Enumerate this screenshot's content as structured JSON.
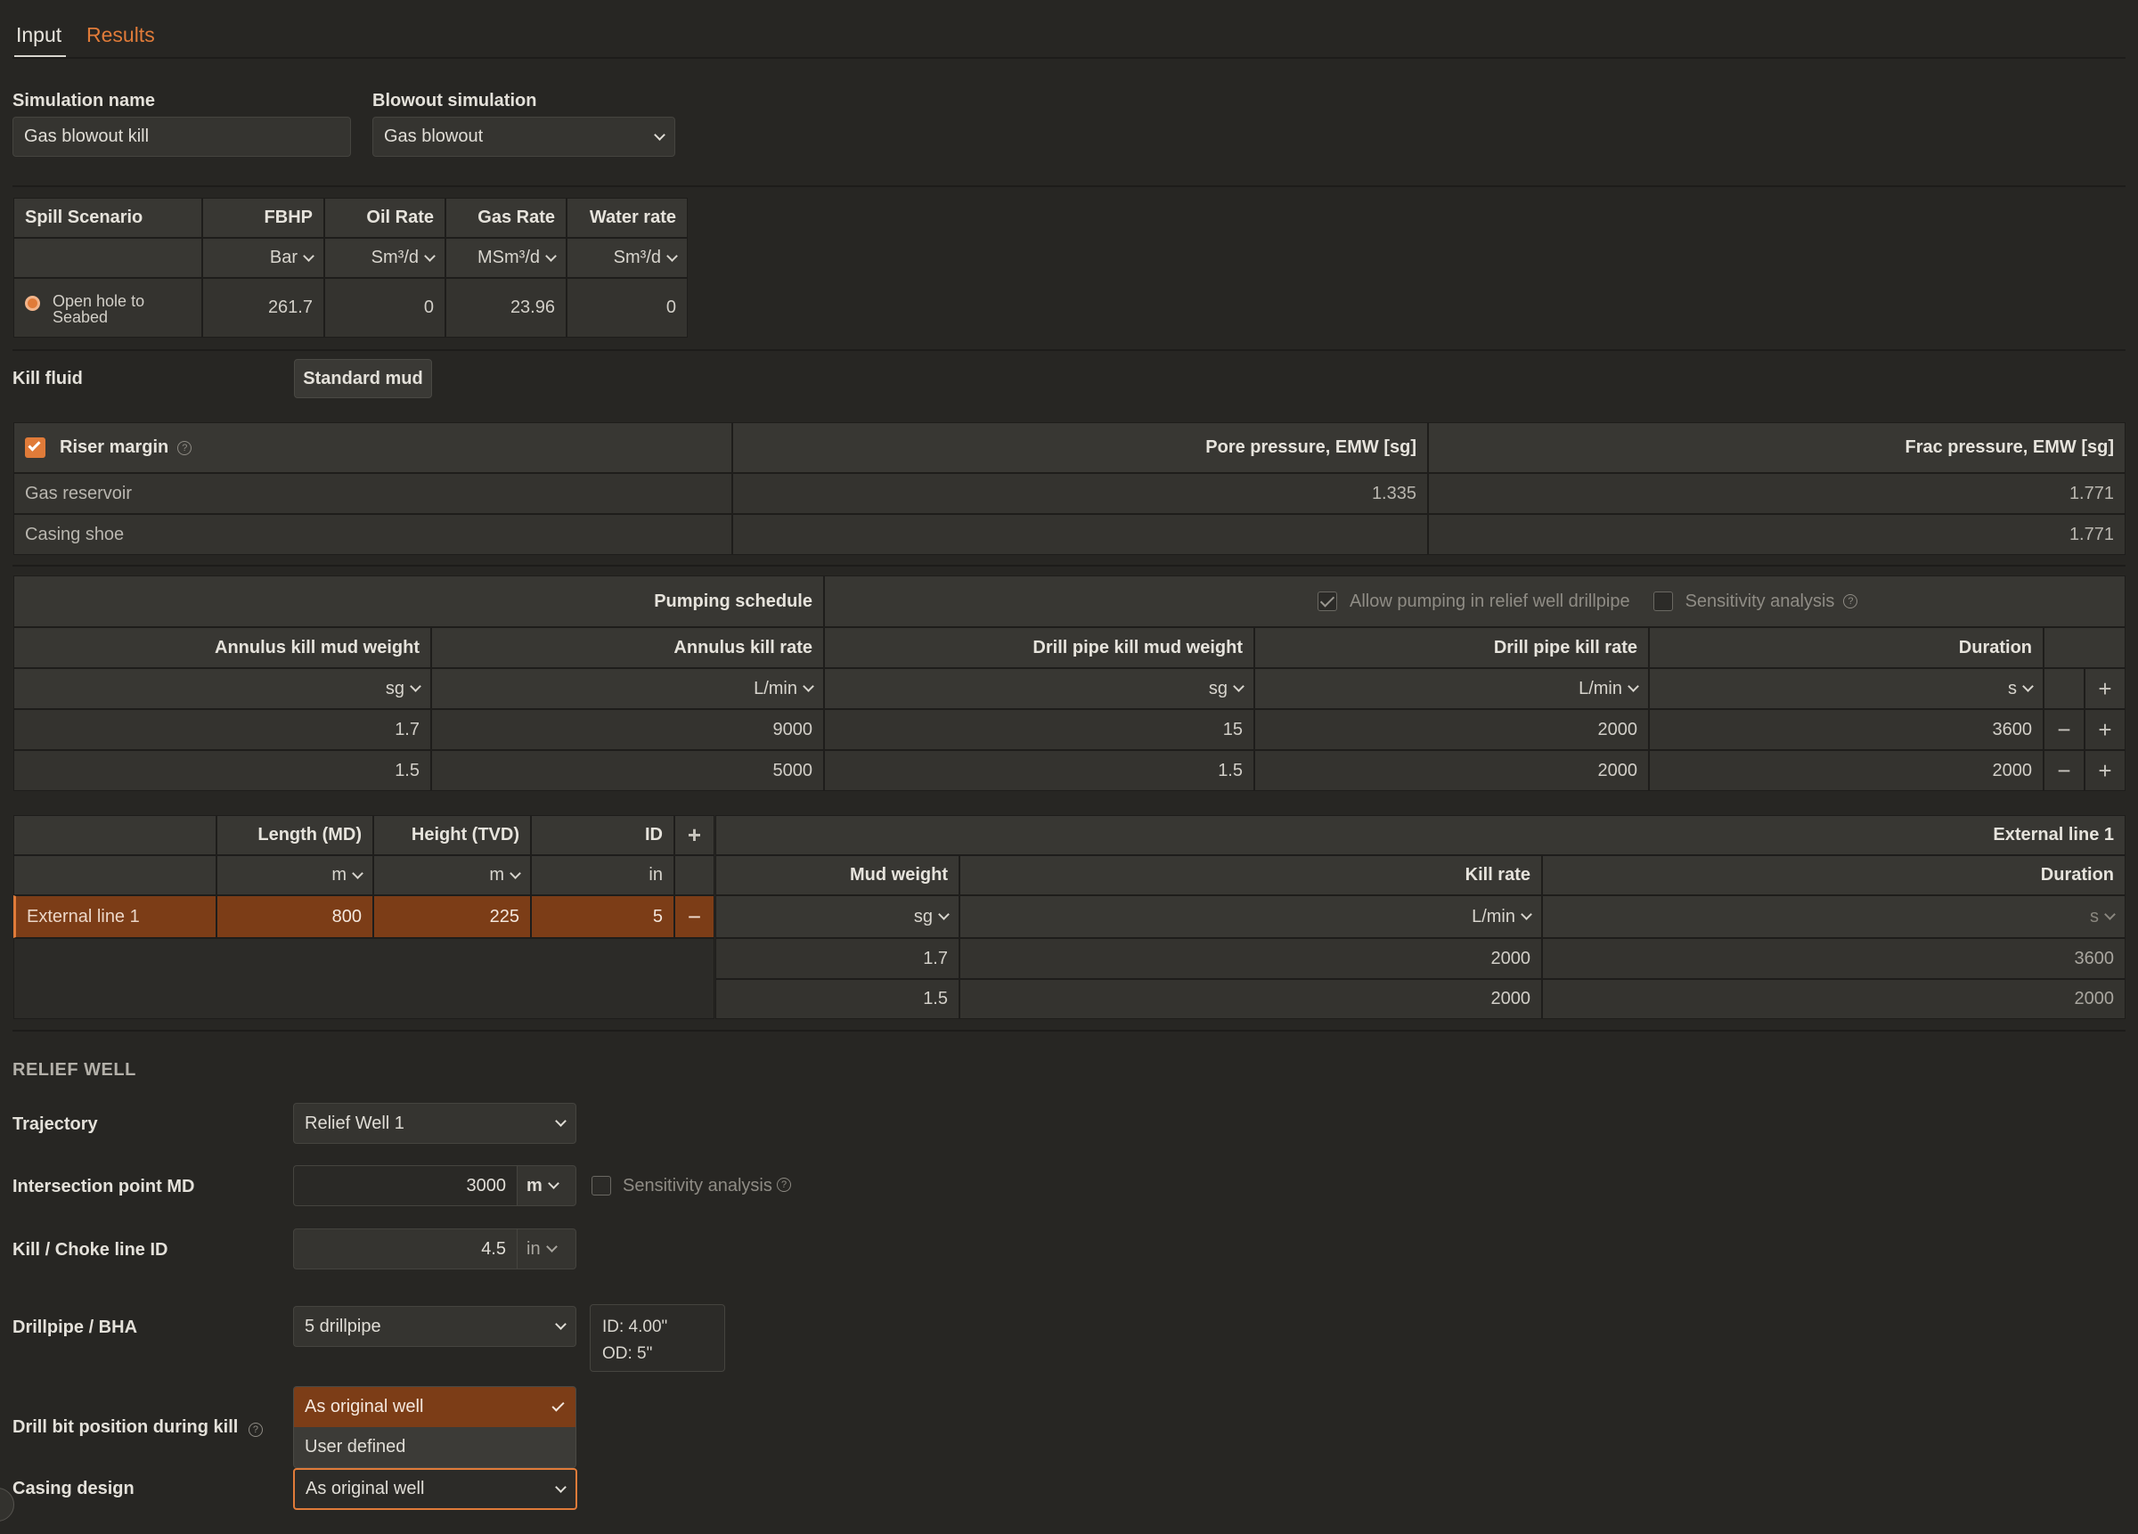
{
  "tabs": {
    "input": "Input",
    "results": "Results"
  },
  "simulation": {
    "name_label": "Simulation name",
    "name_value": "Gas blowout kill",
    "blowout_label": "Blowout simulation",
    "blowout_value": "Gas blowout"
  },
  "spill": {
    "headers": [
      "Spill Scenario",
      "FBHP",
      "Oil Rate",
      "Gas Rate",
      "Water rate"
    ],
    "units": [
      "Bar",
      "Sm³/d",
      "MSm³/d",
      "Sm³/d"
    ],
    "row": {
      "scenario": "Open hole to Seabed",
      "fbhp": "261.7",
      "oil": "0",
      "gas": "23.96",
      "water": "0"
    }
  },
  "kill_fluid": {
    "label": "Kill fluid",
    "button": "Standard mud"
  },
  "margins": {
    "riser_label": "Riser margin",
    "pore_header": "Pore pressure, EMW [sg]",
    "frac_header": "Frac pressure, EMW [sg]",
    "rows": [
      {
        "name": "Gas reservoir",
        "pore": "1.335",
        "frac": "1.771"
      },
      {
        "name": "Casing shoe",
        "pore": "",
        "frac": "1.771"
      }
    ]
  },
  "pumping": {
    "title": "Pumping schedule",
    "allow_label": "Allow pumping in relief well drillpipe",
    "sensitivity_label": "Sensitivity analysis",
    "headers": [
      "Annulus kill mud weight",
      "Annulus kill rate",
      "Drill pipe kill mud weight",
      "Drill pipe kill rate",
      "Duration"
    ],
    "units": [
      "sg",
      "L/min",
      "sg",
      "L/min",
      "s"
    ],
    "rows": [
      [
        "1.7",
        "9000",
        "15",
        "2000",
        "3600"
      ],
      [
        "1.5",
        "5000",
        "1.5",
        "2000",
        "2000"
      ]
    ]
  },
  "lines": {
    "headers": [
      "Length (MD)",
      "Height (TVD)",
      "ID"
    ],
    "units": [
      "m",
      "m",
      "in"
    ],
    "row": {
      "name": "External line 1",
      "length": "800",
      "height": "225",
      "id": "5"
    }
  },
  "ext": {
    "title": "External line 1",
    "headers": [
      "Mud weight",
      "Kill rate",
      "Duration"
    ],
    "units": [
      "sg",
      "L/min",
      "s"
    ],
    "rows": [
      [
        "1.7",
        "2000",
        "3600"
      ],
      [
        "1.5",
        "2000",
        "2000"
      ]
    ]
  },
  "relief": {
    "section": "RELIEF WELL",
    "trajectory_label": "Trajectory",
    "trajectory_value": "Relief Well 1",
    "ip_label": "Intersection point MD",
    "ip_value": "3000",
    "ip_unit": "m",
    "ip_sens": "Sensitivity analysis",
    "kc_label": "Kill / Choke line ID",
    "kc_value": "4.5",
    "kc_unit": "in",
    "dp_label": "Drillpipe / BHA",
    "dp_value": "5 drillpipe",
    "dp_id": "ID:  4.00\"",
    "dp_od": "OD: 5\"",
    "bit_label": "Drill bit position during kill",
    "bit_options": [
      "As original well",
      "User defined"
    ],
    "casing_label": "Casing design",
    "casing_value": "As original well"
  },
  "colors": {
    "accent": "#e07b39",
    "selected_row": "#7c3d17",
    "background": "#272623"
  }
}
